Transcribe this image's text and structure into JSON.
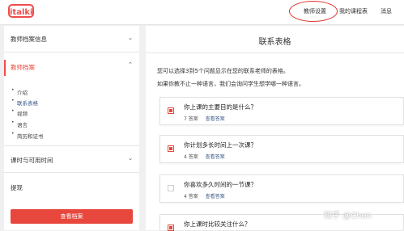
{
  "header": {
    "logo": "italki",
    "nav": [
      {
        "label": "教师设置"
      },
      {
        "label": "我的课程表"
      },
      {
        "label": "消息"
      }
    ]
  },
  "sidebar": {
    "sections": [
      {
        "label": "教师档案信息"
      },
      {
        "label": "教师档案"
      },
      {
        "label": "课时与可用时间"
      },
      {
        "label": "提现"
      }
    ],
    "sub_items": [
      "介绍",
      "联系表格",
      "视频",
      "语言",
      "简历和证书"
    ],
    "cta_label": "查看档案"
  },
  "main": {
    "title": "联系表格",
    "intro_lines": [
      "您可以选择3到5个问题显示在您的联系老师的表格。",
      "如果你教不止一种语言，我们会询问学生想学哪一种语言。"
    ],
    "questions": [
      {
        "title": "你上课的主要目的是什么？",
        "count": "7 答案",
        "link": "查看答案",
        "checked": true
      },
      {
        "title": "你计划多长时间上一次课？",
        "count": "4 答案",
        "link": "查看答案",
        "checked": true
      },
      {
        "title": "你喜欢多久时间的一节课？",
        "count": "4 答案",
        "link": "查看答案",
        "checked": false
      },
      {
        "title": "你上课时比较关注什么？",
        "count": "",
        "link": "",
        "checked": true
      }
    ]
  },
  "watermark": "知乎 @Chen",
  "colors": {
    "accent": "#e8473d",
    "link": "#3b5a89"
  }
}
